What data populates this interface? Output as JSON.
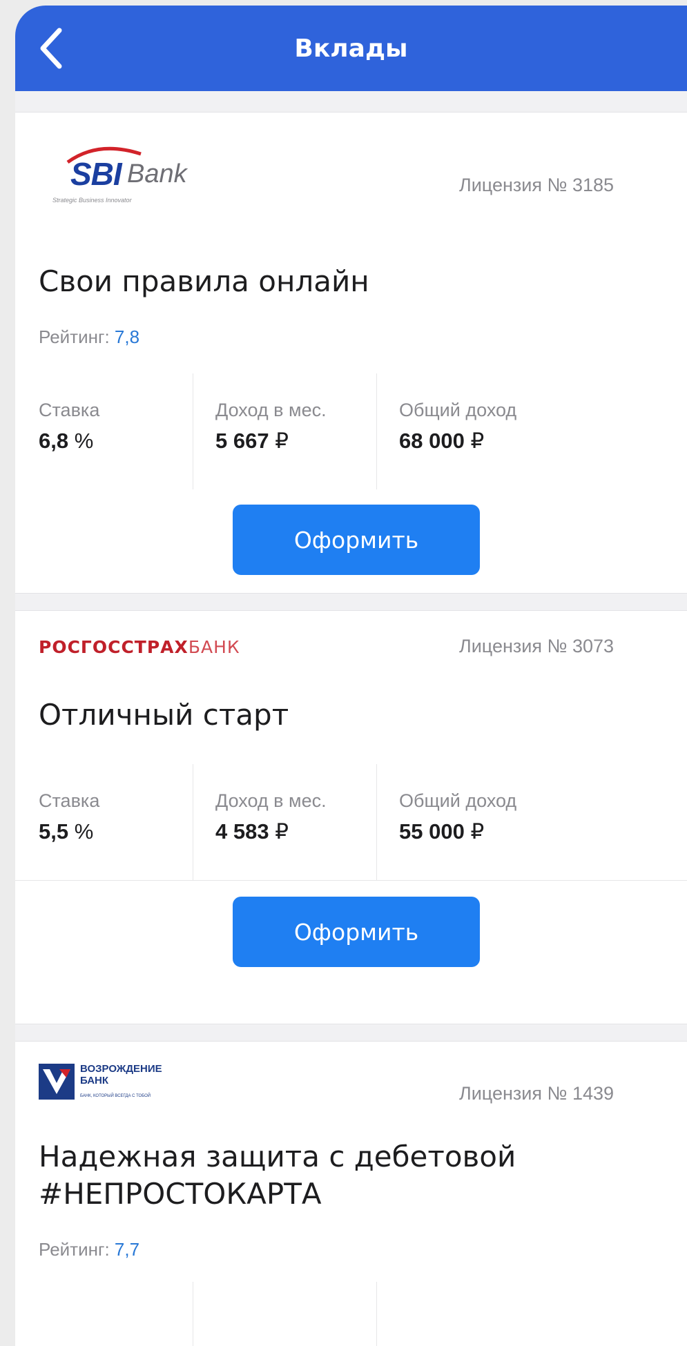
{
  "header": {
    "title": "Вклады"
  },
  "colors": {
    "header_bg": "#2f63db",
    "button_bg": "#1f7ff2",
    "rating_value": "#2878d6"
  },
  "labels": {
    "rate": "Ставка",
    "monthly": "Доход в мес.",
    "total": "Общий доход",
    "rating": "Рейтинг:",
    "apply": "Оформить"
  },
  "deposits": [
    {
      "logo_icon": "sbi-bank-logo",
      "logo_text": "SBI",
      "logo_text2": "Bank",
      "logo_tagline": "Strategic Business Innovator",
      "license": "Лицензия № 3185",
      "title": "Свои правила онлайн",
      "rating": "7,8",
      "rate_value": "6,8",
      "rate_unit": " %",
      "monthly_value": "5 667",
      "monthly_unit": " ₽",
      "total_value": "68 000",
      "total_unit": " ₽"
    },
    {
      "logo_icon": "rosgosstrakh-bank-logo",
      "logo_text": "РОСГОССТРАХ",
      "logo_text2": "БАНК",
      "license": "Лицензия № 3073",
      "title": "Отличный старт",
      "rate_value": "5,5",
      "rate_unit": " %",
      "monthly_value": "4 583",
      "monthly_unit": " ₽",
      "total_value": "55 000",
      "total_unit": " ₽"
    },
    {
      "logo_icon": "vozrozhdenie-bank-logo",
      "logo_text": "ВОЗРОЖДЕНИЕ",
      "logo_text2": "БАНК",
      "logo_tagline": "БАНК, КОТОРЫЙ ВСЕГДА С ТОБОЙ",
      "license": "Лицензия № 1439",
      "title_line1": "Надежная защита с дебетовой",
      "title_line2": "#НЕПРОСТОКАРТА",
      "rating": "7,7"
    }
  ]
}
